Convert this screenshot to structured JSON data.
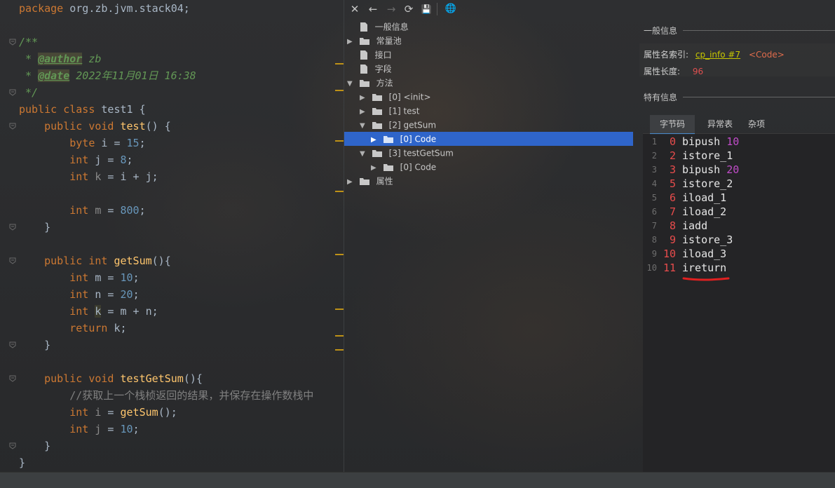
{
  "editor": {
    "lines": [
      {
        "parts": [
          [
            "kw",
            "package "
          ],
          [
            "pkg",
            "org.zb.jvm.stack04;"
          ]
        ]
      },
      {
        "parts": []
      },
      {
        "parts": [
          [
            "cmt",
            "/**"
          ]
        ]
      },
      {
        "parts": [
          [
            "cmt",
            " * "
          ],
          [
            "tag",
            "@author"
          ],
          [
            "cmt",
            " zb"
          ]
        ]
      },
      {
        "parts": [
          [
            "cmt",
            " * "
          ],
          [
            "tag",
            "@date"
          ],
          [
            "cmt",
            " 2022年11月01日 16:38"
          ]
        ]
      },
      {
        "parts": [
          [
            "cmt",
            " */"
          ]
        ]
      },
      {
        "parts": [
          [
            "kw",
            "public class "
          ],
          [
            "pkg",
            "test1 {"
          ]
        ]
      },
      {
        "parts": [
          [
            "pkg",
            "    "
          ],
          [
            "kw",
            "public void "
          ],
          [
            "fn",
            "test"
          ],
          [
            "pkg",
            "() {"
          ]
        ]
      },
      {
        "parts": [
          [
            "pkg",
            "        "
          ],
          [
            "kw",
            "byte "
          ],
          [
            "pkg",
            "i = "
          ],
          [
            "num",
            "15"
          ],
          [
            "pkg",
            ";"
          ]
        ]
      },
      {
        "parts": [
          [
            "pkg",
            "        "
          ],
          [
            "kw",
            "int "
          ],
          [
            "pkg",
            "j = "
          ],
          [
            "num",
            "8"
          ],
          [
            "pkg",
            ";"
          ]
        ]
      },
      {
        "parts": [
          [
            "pkg",
            "        "
          ],
          [
            "kw",
            "int "
          ],
          [
            "unused",
            "k"
          ],
          [
            "pkg",
            " = i + j;"
          ]
        ]
      },
      {
        "parts": []
      },
      {
        "parts": [
          [
            "pkg",
            "        "
          ],
          [
            "kw",
            "int "
          ],
          [
            "unused",
            "m"
          ],
          [
            "pkg",
            " = "
          ],
          [
            "num",
            "800"
          ],
          [
            "pkg",
            ";"
          ]
        ]
      },
      {
        "parts": [
          [
            "pkg",
            "    }"
          ]
        ]
      },
      {
        "parts": []
      },
      {
        "parts": [
          [
            "pkg",
            "    "
          ],
          [
            "kw",
            "public int "
          ],
          [
            "fn",
            "getSum"
          ],
          [
            "pkg",
            "(){"
          ]
        ]
      },
      {
        "parts": [
          [
            "pkg",
            "        "
          ],
          [
            "kw",
            "int "
          ],
          [
            "pkg",
            "m = "
          ],
          [
            "num",
            "10"
          ],
          [
            "pkg",
            ";"
          ]
        ]
      },
      {
        "parts": [
          [
            "pkg",
            "        "
          ],
          [
            "kw",
            "int "
          ],
          [
            "pkg",
            "n = "
          ],
          [
            "num",
            "20"
          ],
          [
            "pkg",
            ";"
          ]
        ]
      },
      {
        "parts": [
          [
            "pkg",
            "        "
          ],
          [
            "kw",
            "int "
          ],
          [
            "khl",
            "k"
          ],
          [
            "pkg",
            " = m + n;"
          ]
        ]
      },
      {
        "parts": [
          [
            "pkg",
            "        "
          ],
          [
            "kw",
            "return "
          ],
          [
            "pkg",
            "k;"
          ]
        ]
      },
      {
        "parts": [
          [
            "pkg",
            "    }"
          ]
        ]
      },
      {
        "parts": []
      },
      {
        "parts": [
          [
            "pkg",
            "    "
          ],
          [
            "kw",
            "public void "
          ],
          [
            "fn",
            "testGetSum"
          ],
          [
            "pkg",
            "(){"
          ]
        ]
      },
      {
        "parts": [
          [
            "pkg",
            "        "
          ],
          [
            "lc",
            "//获取上一个栈桢返回的结果，并保存在操作数栈中"
          ]
        ]
      },
      {
        "parts": [
          [
            "pkg",
            "        "
          ],
          [
            "kw",
            "int "
          ],
          [
            "unused",
            "i"
          ],
          [
            "pkg",
            " = "
          ],
          [
            "fn",
            "getSum"
          ],
          [
            "pkg",
            "();"
          ]
        ]
      },
      {
        "parts": [
          [
            "pkg",
            "        "
          ],
          [
            "kw",
            "int "
          ],
          [
            "unused",
            "j"
          ],
          [
            "pkg",
            " = "
          ],
          [
            "num",
            "10"
          ],
          [
            "pkg",
            ";"
          ]
        ]
      },
      {
        "parts": [
          [
            "pkg",
            "    }"
          ]
        ]
      },
      {
        "parts": [
          [
            "pkg",
            "}"
          ]
        ]
      }
    ]
  },
  "toolbar": {
    "close": "✕",
    "back": "←",
    "forward": "→",
    "refresh": "⟳",
    "save": "💾",
    "web": "🌐"
  },
  "tree": {
    "general": "一般信息",
    "constant_pool": "常量池",
    "interfaces": "接口",
    "fields": "字段",
    "methods": "方法",
    "m0": "[0] <init>",
    "m1": "[1] test",
    "m2": "[2] getSum",
    "m2_code": "[0] Code",
    "m3": "[3] testGetSum",
    "m3_code": "[0] Code",
    "attributes": "属性"
  },
  "info": {
    "general_title": "一般信息",
    "name_index_label": "属性名索引:",
    "name_index_link": "cp_info #7",
    "name_index_value": "<Code>",
    "length_label": "属性长度:",
    "length_value": "96",
    "specific_title": "特有信息",
    "tabs": [
      "字节码",
      "异常表",
      "杂项"
    ]
  },
  "bytecode": [
    {
      "ln": "1",
      "off": "0",
      "op": "bipush",
      "arg": "10"
    },
    {
      "ln": "2",
      "off": "2",
      "op": "istore_1",
      "arg": ""
    },
    {
      "ln": "3",
      "off": "3",
      "op": "bipush",
      "arg": "20"
    },
    {
      "ln": "4",
      "off": "5",
      "op": "istore_2",
      "arg": ""
    },
    {
      "ln": "5",
      "off": "6",
      "op": "iload_1",
      "arg": ""
    },
    {
      "ln": "6",
      "off": "7",
      "op": "iload_2",
      "arg": ""
    },
    {
      "ln": "7",
      "off": "8",
      "op": "iadd",
      "arg": ""
    },
    {
      "ln": "8",
      "off": "9",
      "op": "istore_3",
      "arg": ""
    },
    {
      "ln": "9",
      "off": "10",
      "op": "iload_3",
      "arg": ""
    },
    {
      "ln": "10",
      "off": "11",
      "op": "ireturn",
      "arg": ""
    }
  ],
  "colors": {
    "selection": "#2f65ca",
    "offset": "#e84c4c",
    "operand": "#c04cc8",
    "annotation_underline": "#e02020"
  }
}
